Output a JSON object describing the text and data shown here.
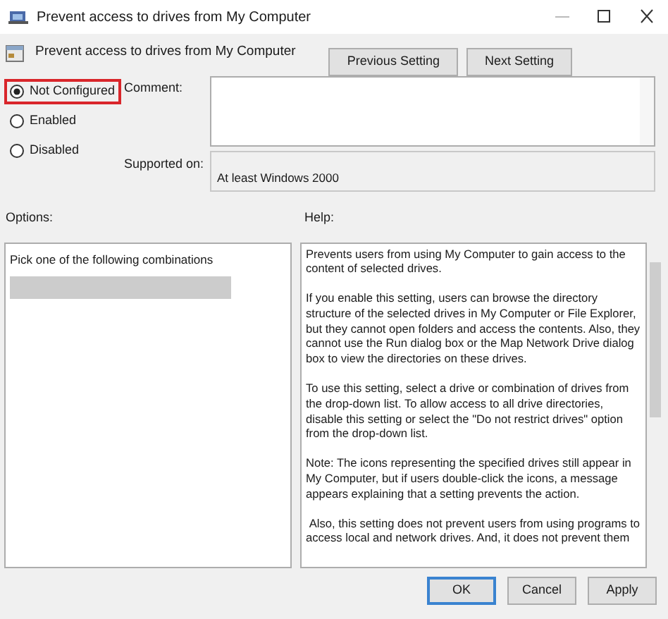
{
  "window": {
    "title": "Prevent access to drives from My Computer"
  },
  "header": {
    "title": "Prevent access to drives from My Computer",
    "buttons": [
      {
        "label": "Previous Setting"
      },
      {
        "label": "Next Setting"
      }
    ]
  },
  "state_options": [
    {
      "label": "Not Configured",
      "selected": true,
      "highlighted": true
    },
    {
      "label": "Enabled",
      "selected": false,
      "highlighted": false
    },
    {
      "label": "Disabled",
      "selected": false,
      "highlighted": false
    }
  ],
  "comment": {
    "label": "Comment:"
  },
  "supported_on": {
    "label": "Supported on:",
    "value": "At least Windows 2000"
  },
  "options": {
    "label": "Options:",
    "text": "Pick one of the following combinations"
  },
  "help": {
    "label": "Help:",
    "paragraphs": [
      "Prevents users from using My Computer to gain access to the content of selected drives.",
      "If you enable this setting, users can browse the directory structure of the selected drives in My Computer or File Explorer, but they cannot open folders and access the contents. Also, they cannot use the Run dialog box or the Map Network Drive dialog box to view the directories on these drives.",
      "To use this setting, select a drive or combination of drives from the drop-down list. To allow access to all drive directories, disable this setting or select the \"Do not restrict drives\" option from the drop-down list.",
      "Note: The icons representing the specified drives still appear in My Computer, but if users double-click the icons, a message appears explaining that a setting prevents the action.",
      " Also, this setting does not prevent users from using programs to access local and network drives. And, it does not prevent them"
    ]
  },
  "footer_buttons": [
    {
      "label": "OK",
      "default": true
    },
    {
      "label": "Cancel",
      "default": false
    },
    {
      "label": "Apply",
      "default": false
    }
  ]
}
